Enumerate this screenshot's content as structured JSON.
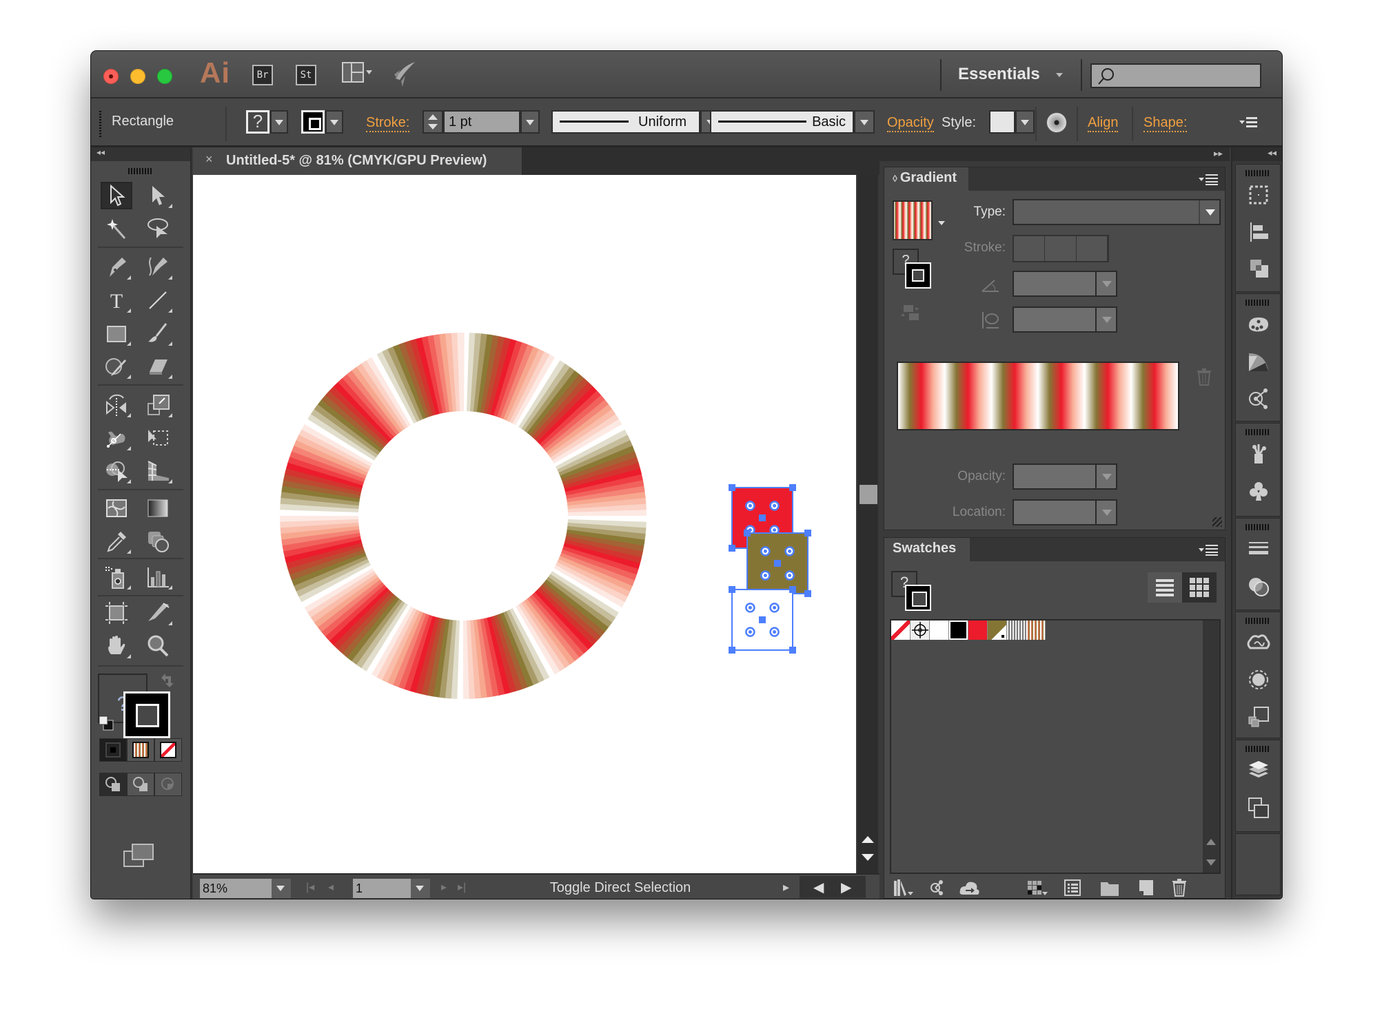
{
  "app": {
    "logo": "Ai",
    "bridge_label": "Br",
    "stock_label": "St",
    "workspace": "Essentials",
    "search_placeholder": ""
  },
  "control_bar": {
    "selection_label": "Rectangle",
    "fill_indicator": "?",
    "stroke_label": "Stroke:",
    "stroke_weight": "1 pt",
    "variable_width_profile": "Uniform",
    "brush_definition": "Basic",
    "opacity_label": "Opacity",
    "style_label": "Style:",
    "align_label": "Align",
    "shape_label": "Shape:"
  },
  "toolbox": {
    "tools": [
      {
        "name": "selection-tool",
        "selected": true
      },
      {
        "name": "direct-selection-tool"
      },
      {
        "name": "magic-wand-tool"
      },
      {
        "name": "lasso-tool"
      },
      {
        "name": "pen-tool"
      },
      {
        "name": "curvature-tool"
      },
      {
        "name": "type-tool"
      },
      {
        "name": "line-segment-tool"
      },
      {
        "name": "rectangle-tool"
      },
      {
        "name": "paintbrush-tool"
      },
      {
        "name": "shaper-tool"
      },
      {
        "name": "eraser-tool"
      },
      {
        "name": "reflect-tool"
      },
      {
        "name": "scale-tool"
      },
      {
        "name": "puppet-warp-tool"
      },
      {
        "name": "free-transform-tool"
      },
      {
        "name": "shape-builder-tool"
      },
      {
        "name": "perspective-grid-tool"
      },
      {
        "name": "mesh-tool"
      },
      {
        "name": "gradient-tool"
      },
      {
        "name": "eyedropper-tool"
      },
      {
        "name": "blend-tool"
      },
      {
        "name": "symbol-sprayer-tool"
      },
      {
        "name": "column-graph-tool"
      },
      {
        "name": "artboard-tool"
      },
      {
        "name": "slice-tool"
      },
      {
        "name": "hand-tool"
      },
      {
        "name": "zoom-tool"
      }
    ],
    "fill_indicator": "?"
  },
  "document": {
    "tab_close": "×",
    "title": "Untitled-5* @ 81% (CMYK/GPU Preview)",
    "zoom": "81%",
    "artboard": "1",
    "status_text": "Toggle Direct Selection"
  },
  "artwork": {
    "ring_colors": [
      "#ffffff",
      "#8b7a36",
      "#ec1c2c",
      "#f7a78e"
    ],
    "rects": [
      {
        "name": "red-square",
        "fill": "#ec1c2c"
      },
      {
        "name": "olive-square",
        "fill": "#857535"
      },
      {
        "name": "white-square",
        "fill": "#ffffff"
      }
    ],
    "selection_color": "#4d7fff"
  },
  "gradient_panel": {
    "title": "Gradient",
    "type_label": "Type:",
    "type_value": "",
    "stroke_label": "Stroke:",
    "angle_value": "",
    "aspect_value": "",
    "opacity_label": "Opacity:",
    "opacity_value": "",
    "location_label": "Location:",
    "location_value": "",
    "stops_colors": [
      "#ffffff",
      "#857535",
      "#ec1c2c",
      "#f9b09a"
    ],
    "repeats": 6,
    "fill_indicator": "?"
  },
  "swatches_panel": {
    "title": "Swatches",
    "fill_indicator": "?",
    "swatches": [
      {
        "name": "none"
      },
      {
        "name": "registration"
      },
      {
        "name": "white",
        "color": "#ffffff"
      },
      {
        "name": "black",
        "color": "#000000"
      },
      {
        "name": "red",
        "color": "#ec1c2c"
      },
      {
        "name": "olive",
        "color": "#857535"
      },
      {
        "name": "gray-stripes-gradient"
      },
      {
        "name": "red-stripes-gradient"
      }
    ]
  },
  "colors": {
    "accent_orange": "#f0a040",
    "panel_bg": "#4a4a4a",
    "chrome_dark": "#2a2a2a"
  }
}
